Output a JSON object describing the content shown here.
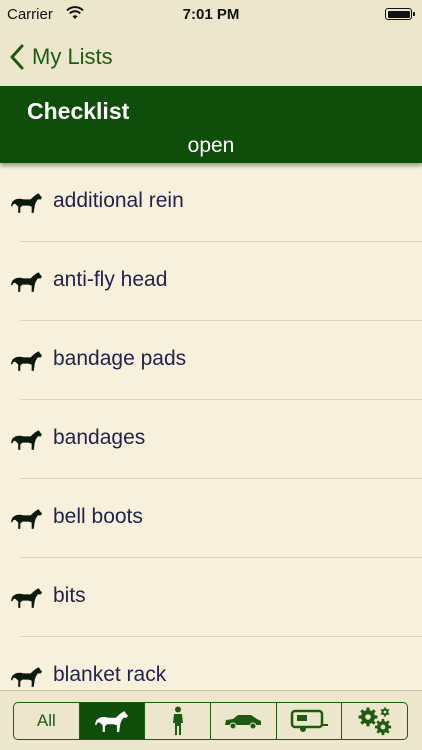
{
  "status_bar": {
    "carrier": "Carrier",
    "time": "7:01 PM"
  },
  "nav": {
    "back_label": "My Lists"
  },
  "header": {
    "title": "Checklist",
    "status": "open"
  },
  "colors": {
    "header_bg": "#0f4d0a",
    "accent": "#1f5a12",
    "item_text": "#24244a",
    "background": "#f6f0dc"
  },
  "items": [
    {
      "label": "additional rein",
      "icon": "horse-icon"
    },
    {
      "label": "anti-fly head",
      "icon": "horse-icon"
    },
    {
      "label": "bandage pads",
      "icon": "horse-icon"
    },
    {
      "label": "bandages",
      "icon": "horse-icon"
    },
    {
      "label": "bell boots",
      "icon": "horse-icon"
    },
    {
      "label": "bits",
      "icon": "horse-icon"
    },
    {
      "label": "blanket rack",
      "icon": "horse-icon"
    }
  ],
  "tabs": [
    {
      "label": "All",
      "icon": null,
      "selected": false
    },
    {
      "label": "",
      "icon": "horse-icon",
      "selected": true
    },
    {
      "label": "",
      "icon": "rider-icon",
      "selected": false
    },
    {
      "label": "",
      "icon": "car-icon",
      "selected": false
    },
    {
      "label": "",
      "icon": "trailer-icon",
      "selected": false
    },
    {
      "label": "",
      "icon": "gears-icon",
      "selected": false
    }
  ]
}
